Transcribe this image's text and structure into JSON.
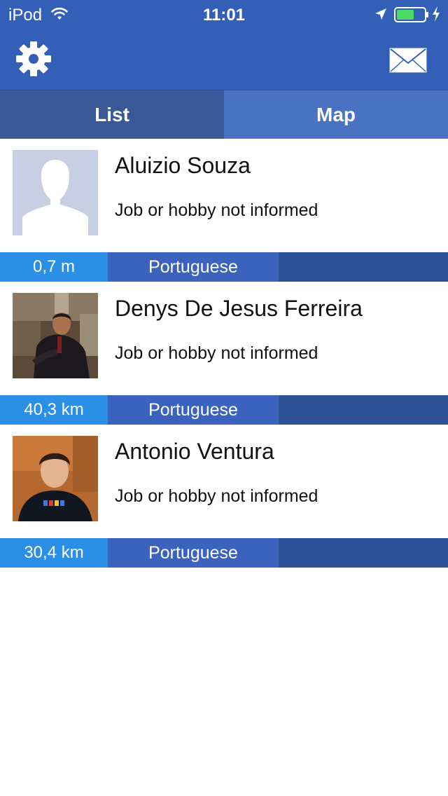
{
  "status_bar": {
    "carrier": "iPod",
    "time": "11:01"
  },
  "colors": {
    "header": "#335fb6",
    "tab_active": "#3a5896",
    "tab_inactive": "#4a72c4",
    "distance_bg": "#2b8fe6",
    "language_bg": "#3b62bc",
    "bar_rest": "#2f5299",
    "battery": "#4cd964"
  },
  "header": {
    "settings_icon": "gear-icon",
    "messages_icon": "mail-icon"
  },
  "tabs": [
    {
      "label": "List",
      "active": true
    },
    {
      "label": "Map",
      "active": false
    }
  ],
  "people": [
    {
      "name": "Aluizio Souza",
      "job": "Job or hobby not informed",
      "distance": "0,7 m",
      "language": "Portuguese",
      "avatar": "default-silhouette"
    },
    {
      "name": "Denys De Jesus Ferreira",
      "job": "Job or hobby not informed",
      "distance": "40,3 km",
      "language": "Portuguese",
      "avatar": "photo"
    },
    {
      "name": "Antonio Ventura",
      "job": "Job or hobby not informed",
      "distance": "30,4 km",
      "language": "Portuguese",
      "avatar": "photo"
    }
  ]
}
